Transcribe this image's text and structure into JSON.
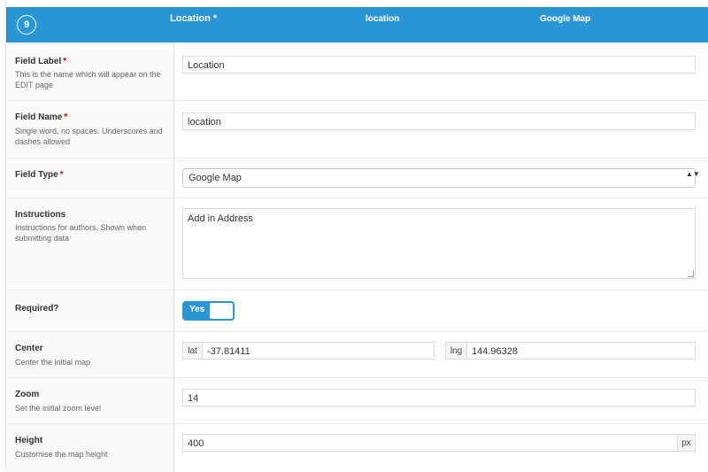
{
  "header": {
    "order": "9",
    "label": "Location *",
    "name": "location",
    "type": "Google Map"
  },
  "fields": {
    "label": {
      "title": "Field Label",
      "required_mark": "*",
      "desc": "This is the name which will appear on the EDIT page",
      "value": "Location"
    },
    "name": {
      "title": "Field Name",
      "required_mark": "*",
      "desc": "Single word, no spaces. Underscores and dashes allowed",
      "value": "location"
    },
    "type": {
      "title": "Field Type",
      "required_mark": "*",
      "selected": "Google Map",
      "arrows": "▲▼"
    },
    "instructions": {
      "title": "Instructions",
      "desc": "Instructions for authors. Shown when submitting data",
      "value": "Add in Address"
    },
    "required": {
      "title": "Required?",
      "toggle_label": "Yes"
    },
    "center": {
      "title": "Center",
      "desc": "Center the initial map",
      "lat_prefix": "lat",
      "lat_value": "-37.81411",
      "lng_prefix": "lng",
      "lng_value": "144.96328"
    },
    "zoom": {
      "title": "Zoom",
      "desc": "Set the initial zoom level",
      "value": "14"
    },
    "height": {
      "title": "Height",
      "desc": "Customise the map height",
      "value": "400",
      "suffix": "px"
    }
  },
  "colors": {
    "accent": "#2a96d6",
    "required": "#dd0000"
  }
}
